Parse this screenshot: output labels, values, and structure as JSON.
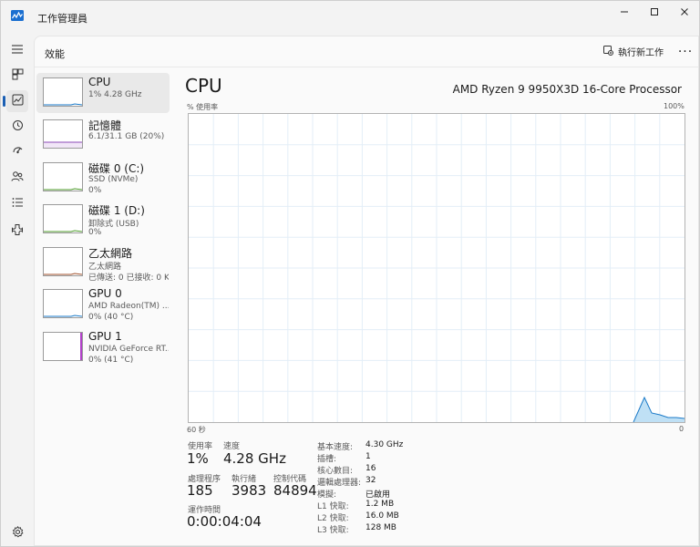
{
  "window": {
    "title": "工作管理員",
    "controls": {
      "minimize": "minimize-icon",
      "maximize": "maximize-icon",
      "close": "close-icon"
    }
  },
  "nav": {
    "items": [
      {
        "icon": "hamburger-menu-icon"
      },
      {
        "icon": "processes-icon"
      },
      {
        "icon": "performance-icon",
        "active": true
      },
      {
        "icon": "app-history-icon"
      },
      {
        "icon": "startup-apps-icon"
      },
      {
        "icon": "users-icon"
      },
      {
        "icon": "details-icon"
      },
      {
        "icon": "services-icon"
      }
    ],
    "settings_icon": "settings-gear-icon"
  },
  "header": {
    "page_title": "效能",
    "run_task_label": "執行新工作",
    "more_label": "···"
  },
  "devices": [
    {
      "name": "CPU",
      "sub1": "1% 4.28 GHz",
      "sub2": "",
      "selected": true,
      "color": "#1b7ac8"
    },
    {
      "name": "記憶體",
      "sub1": "6.1/31.1 GB (20%)",
      "sub2": "",
      "selected": false,
      "color": "#8b4ab7"
    },
    {
      "name": "磁碟 0 (C:)",
      "sub1": "SSD (NVMe)",
      "sub2": "0%",
      "selected": false,
      "color": "#4c9a2a"
    },
    {
      "name": "磁碟 1 (D:)",
      "sub1": "卸除式 (USB)",
      "sub2": "0%",
      "selected": false,
      "color": "#4c9a2a"
    },
    {
      "name": "乙太網路",
      "sub1": "乙太網路",
      "sub2": "已傳送: 0 已接收: 0 Kbps",
      "selected": false,
      "color": "#a0522d"
    },
    {
      "name": "GPU 0",
      "sub1": "AMD Radeon(TM) ...",
      "sub2": "0% (40 °C)",
      "selected": false,
      "color": "#1b7ac8"
    },
    {
      "name": "GPU 1",
      "sub1": "NVIDIA GeForce RT...",
      "sub2": "0% (41 °C)",
      "selected": false,
      "color": "#b040c8"
    }
  ],
  "cpu": {
    "heading": "CPU",
    "model": "AMD Ryzen 9 9950X3D 16-Core Processor",
    "graph": {
      "y_label": "% 使用率",
      "y_max_label": "100%",
      "x_left_label": "60 秒",
      "x_right_label": "0",
      "line_color": "#1b7ac8",
      "fill_color": "#bfe0f5",
      "grid_color": "#e3eef7"
    },
    "stats": {
      "usage_label": "使用率",
      "usage_value": "1%",
      "speed_label": "速度",
      "speed_value": "4.28 GHz",
      "processes_label": "處理程序",
      "processes_value": "185",
      "threads_label": "執行緒",
      "threads_value": "3983",
      "handles_label": "控制代碼",
      "handles_value": "84894",
      "uptime_label": "運作時間",
      "uptime_value": "0:00:04:04"
    },
    "specs": [
      {
        "label": "基本速度:",
        "value": "4.30 GHz"
      },
      {
        "label": "插槽:",
        "value": "1"
      },
      {
        "label": "核心數目:",
        "value": "16"
      },
      {
        "label": "邏輯處理器:",
        "value": "32"
      },
      {
        "label": "模擬:",
        "value": "已啟用"
      },
      {
        "label": "L1 快取:",
        "value": "1.2 MB"
      },
      {
        "label": "L2 快取:",
        "value": "16.0 MB"
      },
      {
        "label": "L3 快取:",
        "value": "128 MB"
      }
    ]
  }
}
